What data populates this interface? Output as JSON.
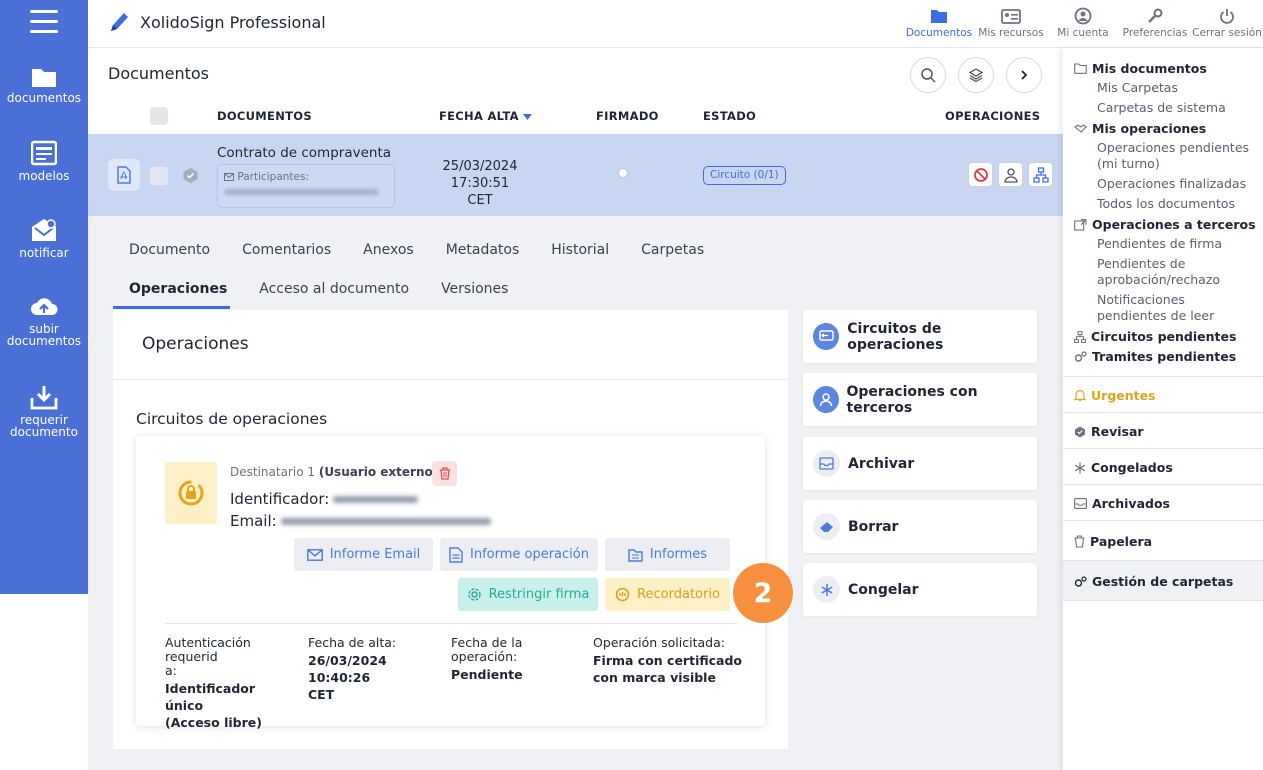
{
  "left_nav": [
    {
      "label": "documentos",
      "icon": "folder-icon"
    },
    {
      "label": "modelos",
      "icon": "template-icon"
    },
    {
      "label": "notificar",
      "icon": "notify-icon"
    },
    {
      "label": "subir\ndocumentos",
      "icon": "upload-icon"
    },
    {
      "label": "requerir\ndocumento",
      "icon": "download-icon"
    }
  ],
  "header": {
    "app_title": "XolidoSign Professional",
    "nav": [
      {
        "label": "Documentos",
        "icon": "folder-icon",
        "active": true
      },
      {
        "label": "Mis recursos",
        "icon": "id-card-icon"
      },
      {
        "label": "Mi cuenta",
        "icon": "user-icon"
      },
      {
        "label": "Preferencias",
        "icon": "wrench-icon"
      },
      {
        "label": "Cerrar sesión",
        "icon": "power-icon"
      }
    ]
  },
  "page": {
    "title": "Documentos"
  },
  "table": {
    "columns": [
      "DOCUMENTOS",
      "FECHA ALTA",
      "FIRMADO",
      "ESTADO",
      "OPERACIONES"
    ],
    "row": {
      "name": "Contrato de compraventa",
      "participants_label": "Participantes:",
      "date": "25/03/2024 17:30:51",
      "tz": "CET",
      "status": "Circuito (0/1)"
    }
  },
  "tabs": {
    "row1": [
      "Documento",
      "Comentarios",
      "Anexos",
      "Metadatos",
      "Historial",
      "Carpetas"
    ],
    "row2": [
      "Operaciones",
      "Acceso al documento",
      "Versiones"
    ],
    "active": "Operaciones"
  },
  "operations": {
    "title": "Operaciones",
    "subtitle": "Circuitos de operaciones",
    "recipient_label": "Destinatario 1",
    "recipient_type": "(Usuario externo)",
    "identifier_label": "Identificador:",
    "email_label": "Email:",
    "buttons": {
      "informe_email": "Informe Email",
      "informe_operacion": "Informe operación",
      "informes": "Informes",
      "restringir": "Restringir firma",
      "recordatorio": "Recordatorio"
    },
    "step_badge": "2",
    "info": [
      {
        "label": "Autenticación requerid\na:",
        "value": "Identificador único\n(Acceso libre)"
      },
      {
        "label": "Fecha de alta:",
        "value": "26/03/2024 10:40:26\nCET"
      },
      {
        "label": "Fecha de la operación:",
        "value": "Pendiente"
      },
      {
        "label": "Operación solicitada:",
        "value": "Firma con certificado\ncon marca visible"
      }
    ]
  },
  "side_actions": [
    {
      "label": "Circuitos de operaciones",
      "icon": "circuit-icon",
      "color": "#5b87e0"
    },
    {
      "label": "Operaciones con terceros",
      "icon": "third-party-icon",
      "color": "#5b87e0"
    },
    {
      "label": "Archivar",
      "icon": "archive-icon",
      "color": "#eceef3"
    },
    {
      "label": "Borrar",
      "icon": "eraser-icon",
      "color": "#eceef3"
    },
    {
      "label": "Congelar",
      "icon": "snowflake-icon",
      "color": "#eceef3"
    }
  ],
  "right_sidebar": {
    "mis_documentos": "Mis documentos",
    "mis_carpetas": "Mis Carpetas",
    "carpetas_sistema": "Carpetas de sistema",
    "mis_operaciones": "Mis operaciones",
    "op_pendientes": "Operaciones pendientes (mi turno)",
    "op_finalizadas": "Operaciones finalizadas",
    "todos_docs": "Todos los documentos",
    "op_terceros": "Operaciones a terceros",
    "pend_firma": "Pendientes de firma",
    "pend_aprob": "Pendientes de aprobación/rechazo",
    "notif_pend": "Notificaciones pendientes de leer",
    "circuitos_pend": "Circuitos pendientes",
    "tramites_pend": "Tramites pendientes",
    "urgentes": "Urgentes",
    "revisar": "Revisar",
    "congelados": "Congelados",
    "archivados": "Archivados",
    "papelera": "Papelera",
    "gestion": "Gestión de carpetas"
  },
  "colors": {
    "primary": "#4a6fd6",
    "accent": "#3d6de0",
    "urgent": "#e0a41c",
    "badge": "#f7913f"
  }
}
